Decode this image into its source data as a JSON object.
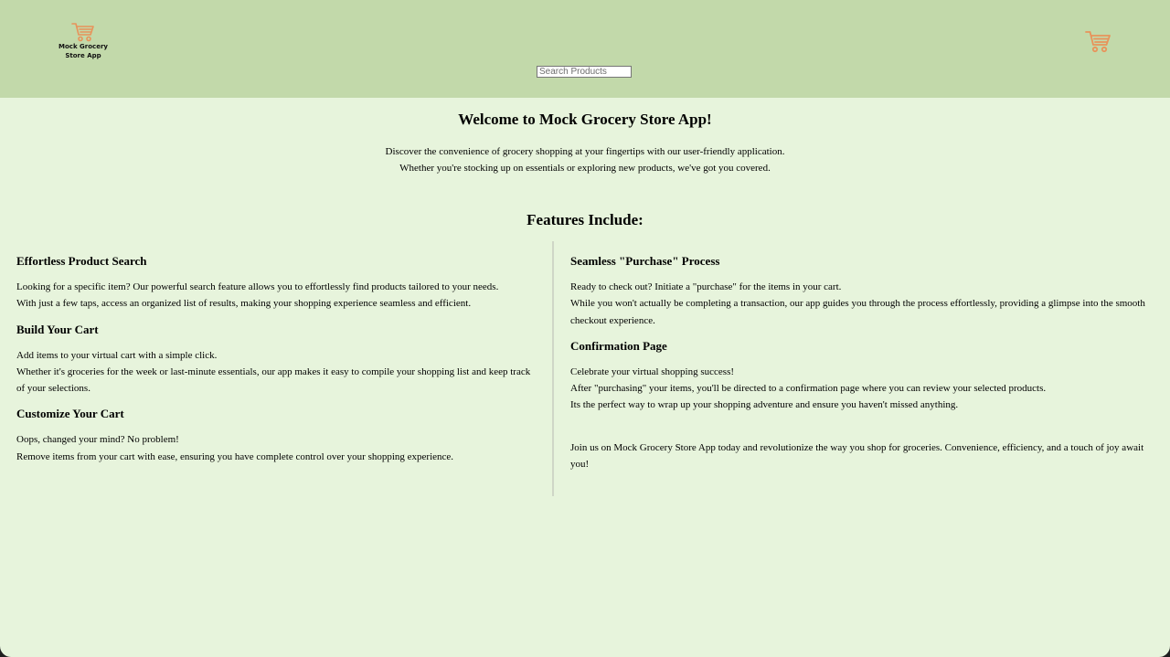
{
  "header": {
    "logo_text": "Mock Grocery Store App",
    "logo_icon": "shopping-cart-icon",
    "cart_icon": "shopping-cart-icon",
    "search_placeholder": "Search Products",
    "search_value": ""
  },
  "intro": {
    "title": "Welcome to Mock Grocery Store App!",
    "line1": "Discover the convenience of grocery shopping at your fingertips with our user-friendly application.",
    "line2": "Whether you're stocking up on essentials or exploring new products, we've got you covered."
  },
  "features": {
    "title": "Features Include:",
    "left": [
      {
        "title": "Effortless Product Search",
        "lines": [
          "Looking for a specific item? Our powerful search feature allows you to effortlessly find products tailored to your needs.",
          "With just a few taps, access an organized list of results, making your shopping experience seamless and efficient."
        ]
      },
      {
        "title": "Build Your Cart",
        "lines": [
          "Add items to your virtual cart with a simple click.",
          "Whether it's groceries for the week or last-minute essentials, our app makes it easy to compile your shopping list and keep track of your selections."
        ]
      },
      {
        "title": "Customize Your Cart",
        "lines": [
          "Oops, changed your mind? No problem!",
          "Remove items from your cart with ease, ensuring you have complete control over your shopping experience."
        ]
      }
    ],
    "right": [
      {
        "title": "Seamless \"Purchase\" Process",
        "lines": [
          "Ready to check out? Initiate a \"purchase\" for the items in your cart.",
          "While you won't actually be completing a transaction, our app guides you through the process effortlessly, providing a glimpse into the smooth checkout experience."
        ]
      },
      {
        "title": "Confirmation Page",
        "lines": [
          "Celebrate your virtual shopping success!",
          "After \"purchasing\" your items, you'll be directed to a confirmation page where you can review your selected products.",
          "Its the perfect way to wrap up your shopping adventure and ensure you haven't missed anything."
        ]
      }
    ],
    "closing": "Join us on Mock Grocery Store App today and revolutionize the way you shop for groceries. Convenience, efficiency, and a touch of joy await you!"
  },
  "colors": {
    "header_bg": "#c2d9aa",
    "page_bg": "#e7f4dc",
    "icon_accent": "#e8935a"
  }
}
